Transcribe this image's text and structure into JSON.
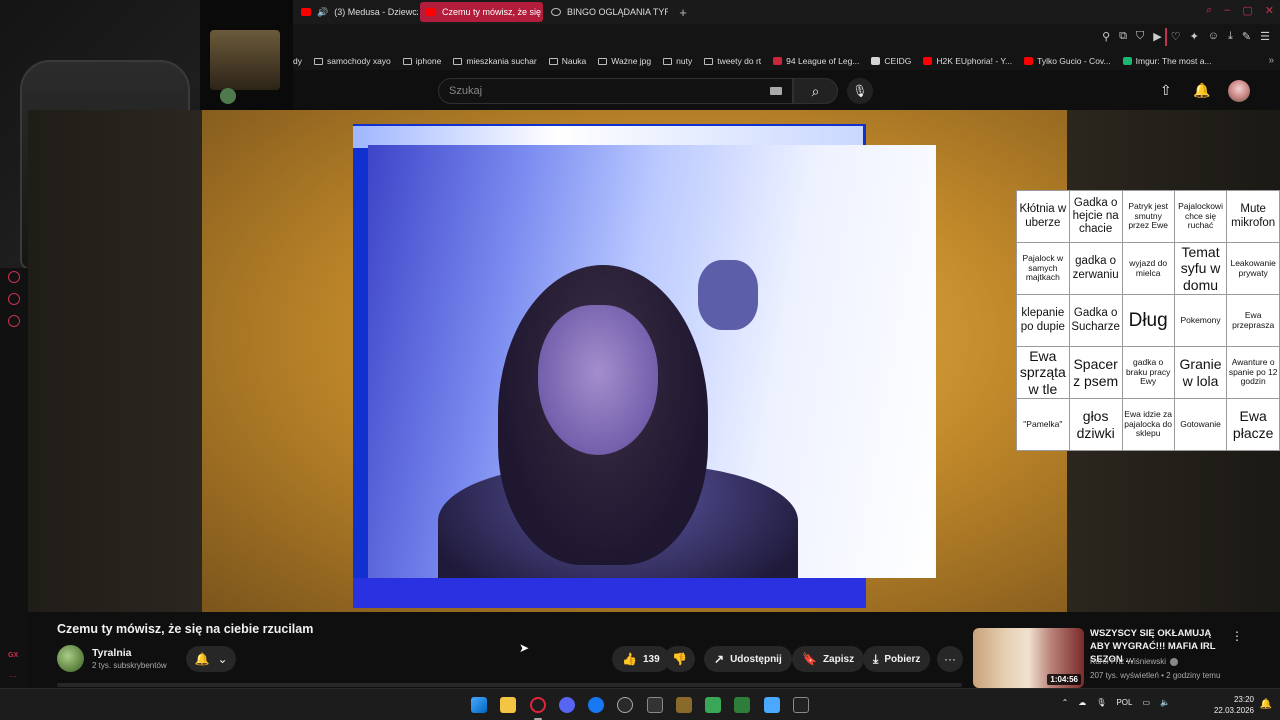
{
  "tabs": [
    {
      "label": "(3) Medusa - Dziewcz",
      "favicon": "youtube-icon",
      "sound": true,
      "active": false
    },
    {
      "label": "Czemu ty mówisz, że się",
      "favicon": "youtube-icon",
      "active": true
    },
    {
      "label": "BINGO OGLĄDANIA TYRA",
      "favicon": "globe-icon",
      "active": false
    }
  ],
  "new_tab_label": "+",
  "bookmarks": [
    {
      "label": "dy",
      "type": "partial"
    },
    {
      "label": "samochody xayo",
      "type": "folder"
    },
    {
      "label": "iphone",
      "type": "folder"
    },
    {
      "label": "mieszkania suchar",
      "type": "folder"
    },
    {
      "label": "Nauka",
      "type": "folder"
    },
    {
      "label": "Ważne jpg",
      "type": "folder"
    },
    {
      "label": "nuty",
      "type": "folder"
    },
    {
      "label": "tweety do rt",
      "type": "folder"
    },
    {
      "label": "94 League of Leg...",
      "type": "site",
      "color": "#c8283a"
    },
    {
      "label": "CEIDG",
      "type": "site",
      "color": "#d4d4d4"
    },
    {
      "label": "H2K EUphoria! - Y...",
      "type": "site",
      "color": "#ff0000"
    },
    {
      "label": "Tylko Gucio - Cov...",
      "type": "site",
      "color": "#ff0000"
    },
    {
      "label": "Imgur: The most a...",
      "type": "site",
      "color": "#1bb76e"
    }
  ],
  "search": {
    "placeholder": "Szukaj"
  },
  "bingo": [
    [
      {
        "t": "Kłótnia w uberze",
        "s": "m"
      },
      {
        "t": "Gadka o hejcie na chacie",
        "s": "m"
      },
      {
        "t": "Patryk jest smutny przez Ewe",
        "s": "s"
      },
      {
        "t": "Pajalockowi chce się ruchać",
        "s": "s"
      },
      {
        "t": "Mute mikrofon",
        "s": "m"
      }
    ],
    [
      {
        "t": "Pajalock w samych majtkach",
        "s": "s"
      },
      {
        "t": "gadka o zerwaniu",
        "s": "m"
      },
      {
        "t": "wyjazd do mielca",
        "s": "s"
      },
      {
        "t": "Temat syfu w domu",
        "s": "l"
      },
      {
        "t": "Leakowanie prywaty",
        "s": "s"
      }
    ],
    [
      {
        "t": "klepanie po dupie",
        "s": "m"
      },
      {
        "t": "Gadka o Sucharze",
        "s": "m"
      },
      {
        "t": "Dług",
        "s": "xl"
      },
      {
        "t": "Pokemony",
        "s": "s"
      },
      {
        "t": "Ewa przeprasza",
        "s": "s"
      }
    ],
    [
      {
        "t": "Ewa sprząta w tle",
        "s": "l"
      },
      {
        "t": "Spacer z psem",
        "s": "l"
      },
      {
        "t": "gadka o braku pracy Ewy",
        "s": "s"
      },
      {
        "t": "Granie w lola",
        "s": "l"
      },
      {
        "t": "Awanture o spanie po 12 godzin",
        "s": "s"
      }
    ],
    [
      {
        "t": "\"Pamelka\"",
        "s": "s"
      },
      {
        "t": "głos dziwki",
        "s": "l"
      },
      {
        "t": "Ewa idzie za pajalocka do sklepu",
        "s": "s"
      },
      {
        "t": "Gotowanie",
        "s": "s"
      },
      {
        "t": "Ewa płacze",
        "s": "l"
      }
    ]
  ],
  "video": {
    "title": "Czemu ty mówisz, że się na ciebie rzucilam",
    "channel": "Tyralnia",
    "subscribers": "2 tys. subskrybentów",
    "likes": "139",
    "share_label": "Udostępnij",
    "save_label": "Zapisz",
    "download_label": "Pobierz"
  },
  "recommendation": {
    "title": "WSZYSCY SIĘ OKŁAMUJĄ ABY WYGRAĆ!!! MAFIA IRL SEZON ...",
    "channel": "Karol Friz Wiśniewski",
    "meta": "207 tys. wyświetleń • 2 godziny temu",
    "duration": "1:04:56"
  },
  "sidebar_label": "GX",
  "tray": {
    "language": "POL",
    "time": "23:20",
    "date": "22.03.2026"
  },
  "colors": {
    "accent": "#c5324f",
    "active_tab": "#b11d3a",
    "youtube_red": "#ff0000"
  }
}
